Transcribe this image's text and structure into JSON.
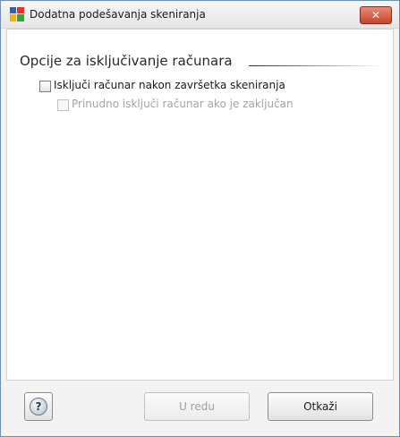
{
  "window": {
    "title": "Dodatna podešavanja skeniranja",
    "app_icon": "avg-logo-icon",
    "close_icon": "close-icon",
    "close_glyph": "✕"
  },
  "main": {
    "section_title": "Opcije za isključivanje računara",
    "options": [
      {
        "label": "Isključi računar nakon završetka skeniranja",
        "checked": false,
        "enabled": true
      },
      {
        "label": "Prinudno isključi računar ako je zaključan",
        "checked": false,
        "enabled": false
      }
    ]
  },
  "footer": {
    "help_icon": "help-icon",
    "help_glyph": "?",
    "ok_label": "U redu",
    "cancel_label": "Otkaži"
  },
  "colors": {
    "accent_border": "#6f8fb8",
    "close_red": "#c4442a",
    "disabled_text": "#a3a3a3"
  }
}
